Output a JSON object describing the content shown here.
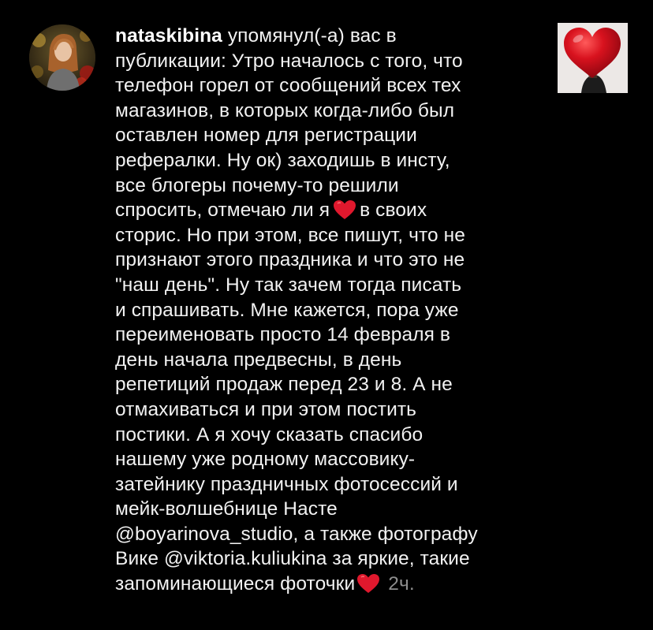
{
  "notification": {
    "username": "nataskibina",
    "action": "упомянул(-а) вас в",
    "lines": [
      "публикации: Утро началось с того, что",
      "телефон горел от сообщений всех тех",
      "магазинов, в которых когда-либо был",
      "оставлен номер для регистрации",
      "рефералки. Ну ок) заходишь в инсту,",
      "все блогеры почему-то решили"
    ],
    "line_heart_before": "спросить, отмечаю ли я",
    "line_heart_after": "в своих",
    "lines_after": [
      "сторис. Но при этом, все пишут, что не",
      "признают этого праздника и что это не",
      "\"наш день\". Ну так зачем тогда писать",
      "и спрашивать. Мне кажется, пора уже",
      "переименовать просто 14 февраля в",
      "день начала предвесны, в день",
      "репетиций продаж перед 23 и 8. А не",
      "отмахиваться и при этом постить",
      "постики.  А я хочу сказать спасибо",
      "нашему уже родному массовику-",
      "затейнику праздничных фотосессий и",
      "мейк-волшебнице Насте",
      "@boyarinova_studio, а также фотографу",
      "Вике @viktoria.kuliukina за яркие, такие"
    ],
    "last_line": "запоминающиеся фоточки",
    "timestamp": "2ч.",
    "avatar_icon": "user-avatar-photo",
    "thumbnail_icon": "post-thumbnail-red-heart-balloon",
    "heart_emoji": "red-heart-emoji",
    "colors": {
      "background": "#000000",
      "text": "#f2f2f2",
      "timestamp": "#8e8e8e",
      "heart": "#e0182d"
    }
  }
}
